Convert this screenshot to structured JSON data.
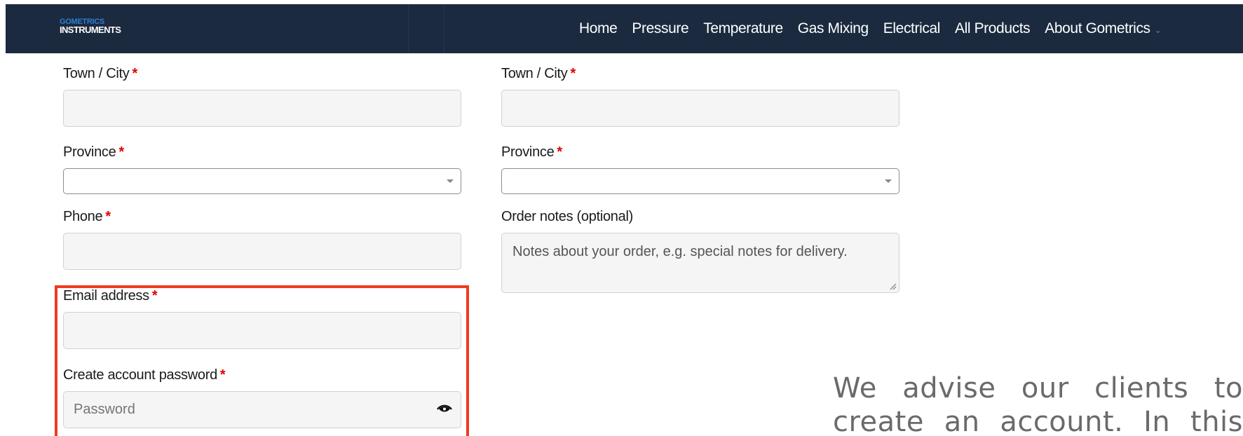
{
  "logo": {
    "line1": "GOMETRICS",
    "line2": "INSTRUMENTS"
  },
  "nav": {
    "items": [
      {
        "label": "Home"
      },
      {
        "label": "Pressure"
      },
      {
        "label": "Temperature"
      },
      {
        "label": "Gas Mixing"
      },
      {
        "label": "Electrical"
      },
      {
        "label": "All Products"
      },
      {
        "label": "About Gometrics"
      }
    ],
    "dropdown_icon": "chevron-down-icon"
  },
  "billing": {
    "city_label": "Town / City",
    "province_label": "Province",
    "phone_label": "Phone",
    "email_label": "Email address",
    "password_label": "Create account password",
    "password_placeholder": "Password"
  },
  "shipping": {
    "city_label": "Town / City",
    "province_label": "Province",
    "notes_label": "Order notes (optional)",
    "notes_placeholder": "Notes about your order, e.g. special notes for delivery."
  },
  "required_marker": "*",
  "side_text": "We advise our clients to create an account. In this",
  "colors": {
    "navbar": "#1b2a3f",
    "required": "#e00000",
    "highlight": "#f03a1e",
    "logo_accent": "#2a7fd4"
  }
}
